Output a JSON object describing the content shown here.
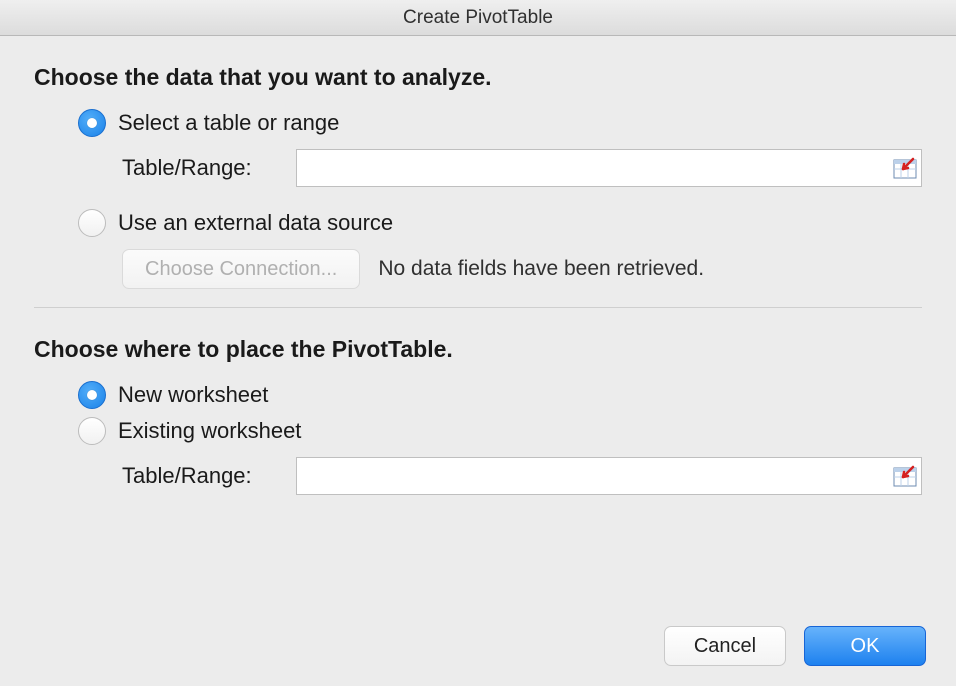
{
  "title": "Create PivotTable",
  "section1": {
    "heading": "Choose the data that you want to analyze.",
    "option_select_range": "Select a table or range",
    "table_range_label": "Table/Range:",
    "table_range_value": "",
    "option_external": "Use an external data source",
    "choose_connection_label": "Choose Connection...",
    "status_text": "No data fields have been retrieved."
  },
  "section2": {
    "heading": "Choose where to place the PivotTable.",
    "option_new_ws": "New worksheet",
    "option_existing_ws": "Existing worksheet",
    "table_range_label": "Table/Range:",
    "table_range_value": ""
  },
  "footer": {
    "cancel": "Cancel",
    "ok": "OK"
  }
}
